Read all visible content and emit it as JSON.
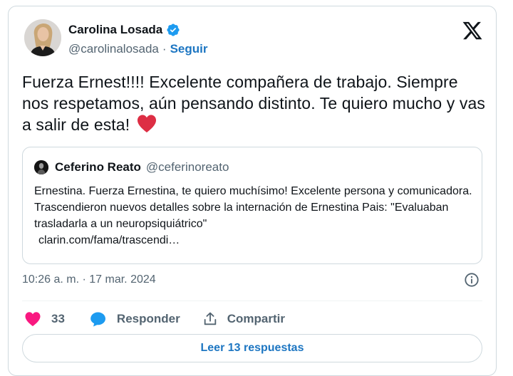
{
  "author": {
    "name": "Carolina Losada",
    "handle": "@carolinalosada",
    "separator": "·",
    "follow_label": "Seguir"
  },
  "tweet": {
    "text": "Fuerza Ernest!!!! Excelente compañera de trabajo. Siempre nos respetamos, aún pensando distinto. Te quiero mucho y vas a salir de esta!",
    "emoji": "heart-emoji"
  },
  "quoted": {
    "name": "Ceferino Reato",
    "handle": "@ceferinoreato",
    "text": "Ernestina. Fuerza Ernestina, te quiero muchísimo! Excelente persona y comunicadora. Trascendieron nuevos detalles sobre la internación de Ernestina Pais: \"Evaluaban trasladarla a un neuropsiquiátrico\"",
    "link": "clarin.com/fama/trascendi…"
  },
  "meta": {
    "timestamp": "10:26 a. m. · 17 mar. 2024"
  },
  "actions": {
    "likes": "33",
    "reply_label": "Responder",
    "share_label": "Compartir"
  },
  "read_replies_label": "Leer 13 respuestas",
  "colors": {
    "accent": "#1d76c2",
    "like": "#f91880",
    "reply_icon": "#1d9bf0",
    "muted": "#536471",
    "border": "#cfd9de"
  }
}
